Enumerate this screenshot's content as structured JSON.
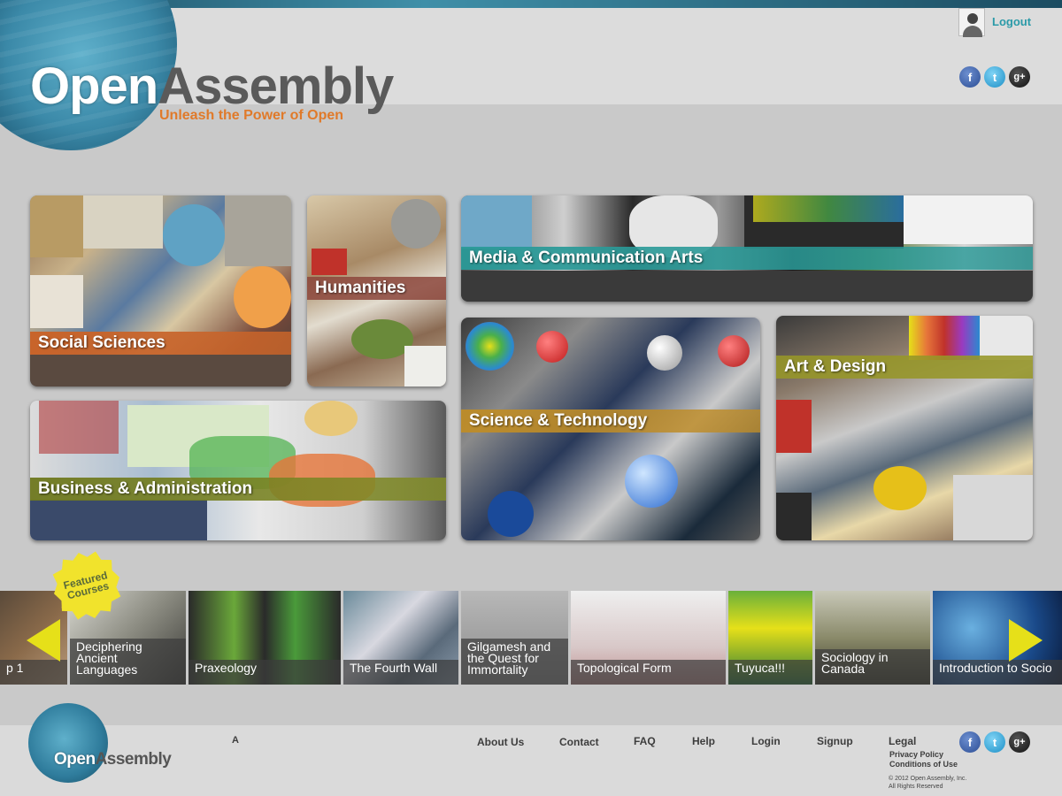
{
  "header": {
    "logo_open": "Open",
    "logo_assembly": "Assembly",
    "tagline": "Unleash the Power of Open",
    "logout_label": "Logout",
    "social_icons": [
      "facebook-icon",
      "twitter-icon",
      "google-plus-icon"
    ]
  },
  "categories": {
    "social_sciences": "Social Sciences",
    "humanities": "Humanities",
    "media": "Media & Communication Arts",
    "business": "Business & Administration",
    "science": "Science & Technology",
    "art": "Art & Design"
  },
  "featured": {
    "badge_line1": "Featured",
    "badge_line2": "Courses",
    "courses": [
      {
        "title": "p 1"
      },
      {
        "title": "Deciphering Ancient Languages"
      },
      {
        "title": "Praxeology"
      },
      {
        "title": "The Fourth Wall"
      },
      {
        "title": "Gilgamesh and the Quest for Immortality"
      },
      {
        "title": "Topological Form"
      },
      {
        "title": "Tuyuca!!!"
      },
      {
        "title": "Sociology in Canada"
      },
      {
        "title": "Introduction to Socio"
      }
    ]
  },
  "footer": {
    "logo_open": "Open",
    "logo_assembly": "Assembly",
    "stray_char": "A",
    "nav": {
      "about": "About Us",
      "contact": "Contact",
      "faq": "FAQ",
      "help": "Help",
      "login": "Login",
      "signup": "Signup",
      "legal": "Legal"
    },
    "privacy": "Privacy Policy",
    "terms": "Conditions of Use",
    "copyright_line1": "© 2012 Open Assembly, Inc.",
    "copyright_line2": "All Rights Reserved"
  },
  "colors": {
    "accent_orange": "#e07a2a",
    "teal": "#2a9aa8",
    "badge_yellow": "#f1e32c",
    "arrow_yellow": "#e6e019"
  }
}
